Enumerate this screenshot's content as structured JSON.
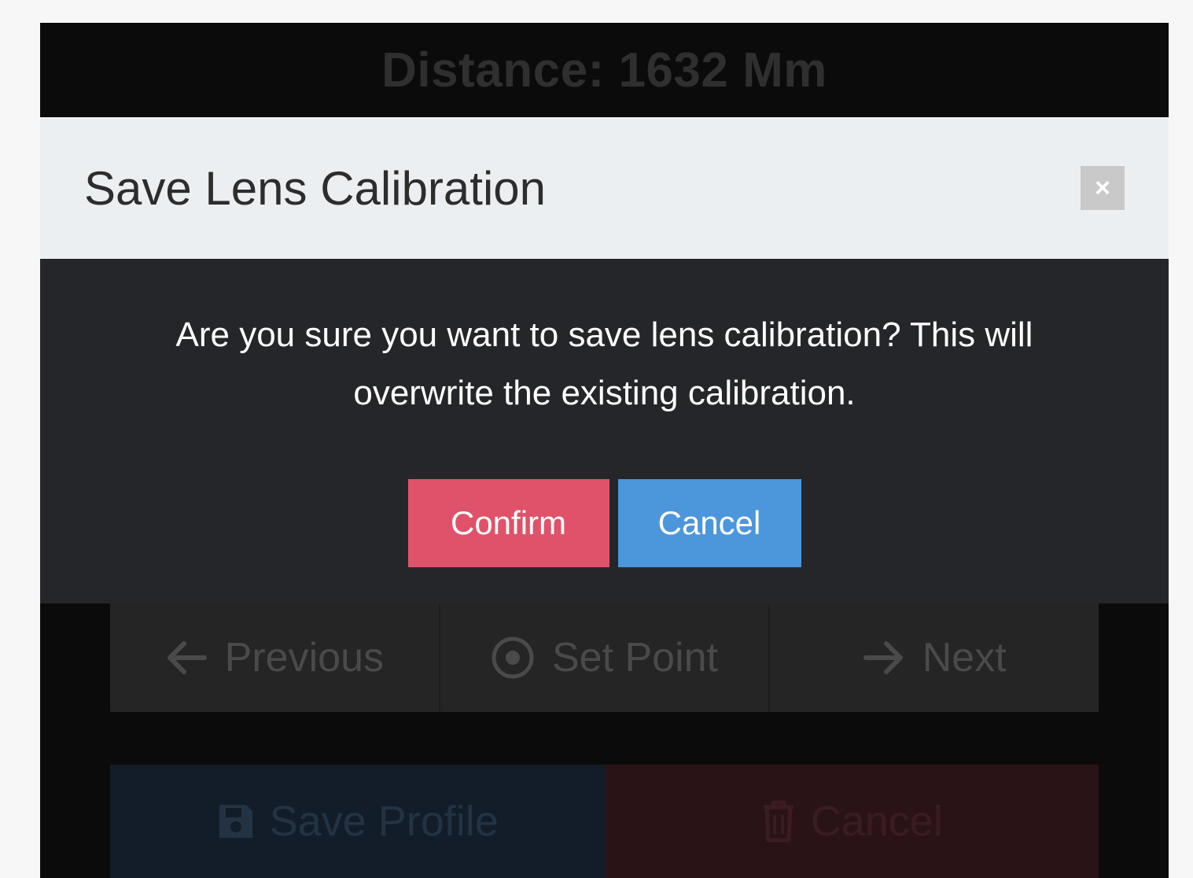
{
  "background": {
    "distance_text": "Distance: 1632  Mm",
    "nav": {
      "previous_label": "Previous",
      "set_point_label": "Set Point",
      "next_label": "Next"
    },
    "actions": {
      "save_label": "Save Profile",
      "cancel_label": "Cancel"
    }
  },
  "modal": {
    "title": "Save Lens Calibration",
    "close_symbol": "×",
    "message": "Are you sure you want to save lens calibration? This will overwrite the existing calibration.",
    "confirm_label": "Confirm",
    "cancel_label": "Cancel"
  },
  "icons": {
    "previous": "arrow-left-icon",
    "set_point": "target-icon",
    "next": "arrow-right-icon",
    "save": "floppy-disk-icon",
    "cancel": "trash-icon",
    "close": "close-icon"
  },
  "colors": {
    "confirm": "#e0526a",
    "cancel": "#4c96db",
    "modal_header": "#eceff1",
    "modal_body": "#25262a"
  }
}
